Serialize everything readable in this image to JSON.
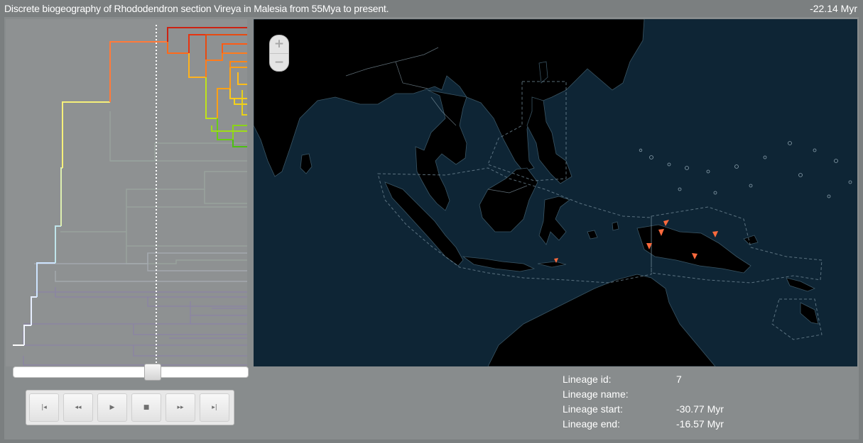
{
  "header": {
    "title": "Discrete biogeography of Rhododendron section Vireya in Malesia from 55Mya to present.",
    "time": "-22.14 Myr"
  },
  "zoom": {
    "in_label": "+",
    "out_label": "−"
  },
  "timeline": {
    "position_fraction": 0.6
  },
  "playback": {
    "buttons": [
      {
        "name": "skip-to-start",
        "glyph": "|◂"
      },
      {
        "name": "rewind",
        "glyph": "◂◂"
      },
      {
        "name": "play",
        "glyph": "▶"
      },
      {
        "name": "stop",
        "glyph": "■"
      },
      {
        "name": "fast-forward",
        "glyph": "▸▸"
      },
      {
        "name": "skip-to-end",
        "glyph": "▸|"
      }
    ]
  },
  "lineage_info": {
    "id_label": "Lineage id:",
    "id_value": "7",
    "name_label": "Lineage name:",
    "name_value": "",
    "start_label": "Lineage start:",
    "start_value": "-30.77 Myr",
    "end_label": "Lineage end:",
    "end_value": "-16.57 Myr"
  },
  "colors": {
    "tree_background": "#8e9192",
    "map_ocean": "#0e2535",
    "land": "#000000",
    "lineage_marker": "#ff6a3d"
  }
}
